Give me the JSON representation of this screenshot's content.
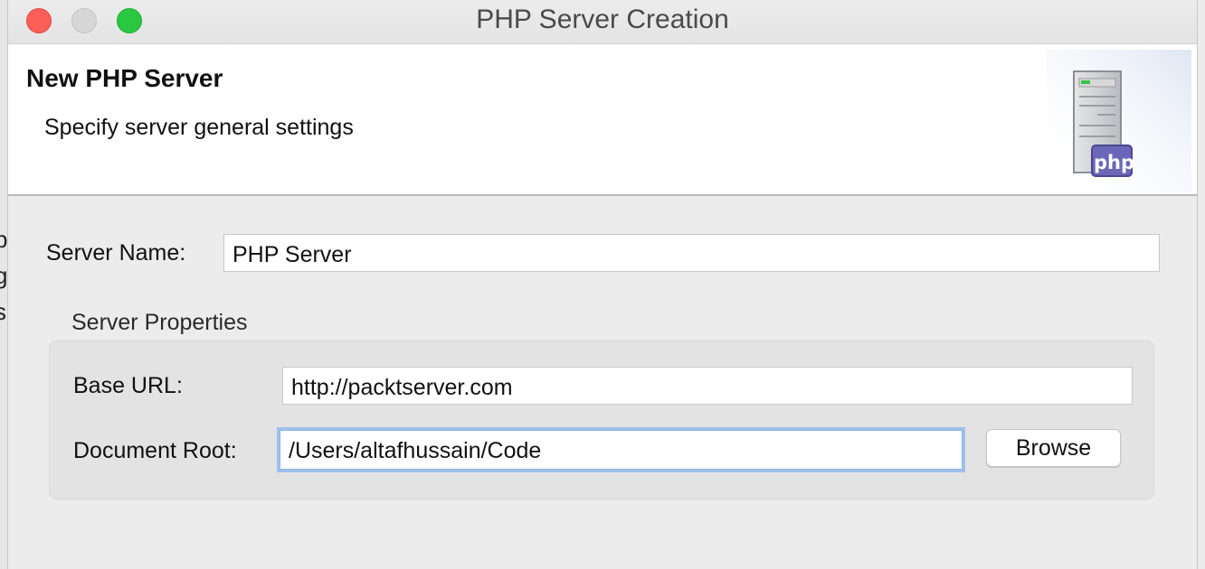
{
  "window": {
    "title": "PHP Server Creation"
  },
  "banner": {
    "title": "New PHP Server",
    "subtitle": "Specify server general settings",
    "icon_text": "php"
  },
  "form": {
    "server_name_label": "Server Name:",
    "server_name_value": "PHP Server",
    "group_title": "Server Properties",
    "base_url_label": "Base URL:",
    "base_url_value": "http://packtserver.com",
    "document_root_label": "Document Root:",
    "document_root_value": "/Users/altafhussain/Code",
    "browse_label": "Browse"
  },
  "colors": {
    "close_light": "#fc5f57",
    "zoom_light": "#29c840",
    "focus_ring": "#9fc0ea",
    "php_badge": "#6a66b8"
  }
}
